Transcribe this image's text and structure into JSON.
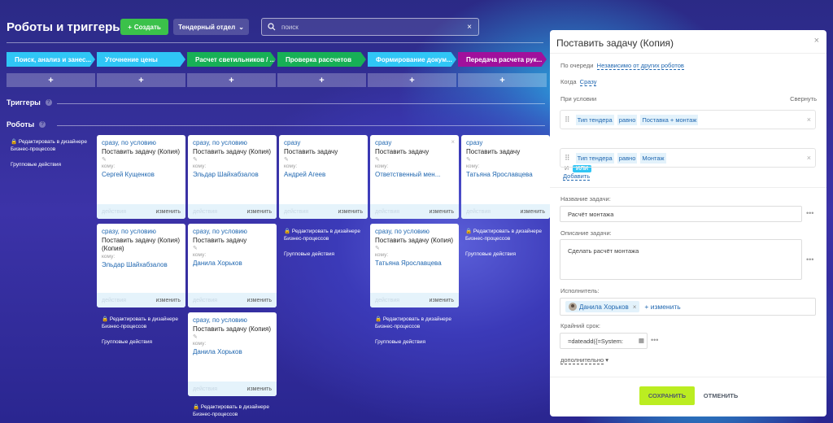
{
  "header": {
    "title": "Роботы и триггеры",
    "create_label": "Создать",
    "department_label": "Тендерный отдел",
    "search_placeholder": "поиск"
  },
  "stages": [
    {
      "label": "Поиск, анализ и занес...",
      "color": "#2fc6f6"
    },
    {
      "label": "Уточнение цены",
      "color": "#2fc6f6"
    },
    {
      "label": "Расчет светильников / ...",
      "color": "#17b056"
    },
    {
      "label": "Проверка рассчетов",
      "color": "#17b056"
    },
    {
      "label": "Формирование докум...",
      "color": "#2fc6f6"
    },
    {
      "label": "Передача расчета рук...",
      "color": "#a0109c"
    }
  ],
  "sections": {
    "triggers": "Триггеры",
    "robots": "Роботы"
  },
  "side_info": {
    "edit_line1": "Редактировать в дизайнере",
    "edit_line2": "Бизнес-процессов",
    "group_actions": "Групповые действия"
  },
  "cards": [
    {
      "cond": "сразу, по условию",
      "name": "Поставить задачу (Копия)",
      "to": "кому:",
      "assignee": "Сергей Кущенков",
      "footer_left": "действия",
      "footer_right": "изменить"
    },
    {
      "cond": "сразу, по условию",
      "name": "Поставить задачу (Копия)",
      "to": "кому:",
      "assignee": "Эльдар Шайхабзалов",
      "footer_left": "действия",
      "footer_right": "изменить"
    },
    {
      "cond": "сразу",
      "name": "Поставить задачу",
      "to": "кому:",
      "assignee": "Андрей Агеев",
      "footer_left": "действия",
      "footer_right": "изменить"
    },
    {
      "cond": "сразу",
      "name": "Поставить задачу",
      "to": "кому:",
      "assignee": "Ответственный мен...",
      "footer_left": "действия",
      "footer_right": "изменить"
    },
    {
      "cond": "сразу",
      "name": "Поставить задачу",
      "to": "кому:",
      "assignee": "Татьяна Ярославцева",
      "footer_left": "действия",
      "footer_right": "изменить"
    },
    {
      "cond": "сразу, по условию",
      "name": "Поставить задачу (Копия) (Копия)",
      "to": "кому:",
      "assignee": "Эльдар Шайхабзалов",
      "footer_left": "действия",
      "footer_right": "изменить"
    },
    {
      "cond": "сразу, по условию",
      "name": "Поставить задачу",
      "to": "кому:",
      "assignee": "Данила Хорьков",
      "footer_left": "действия",
      "footer_right": "изменить"
    },
    {
      "cond": "сразу, по условию",
      "name": "Поставить задачу (Копия)",
      "to": "кому:",
      "assignee": "Татьяна Ярославцева",
      "footer_left": "действия",
      "footer_right": "изменить"
    },
    {
      "cond": "сразу, по условию",
      "name": "Поставить задачу (Копия)",
      "to": "кому:",
      "assignee": "Данила Хорьков",
      "footer_left": "действия",
      "footer_right": "изменить"
    }
  ],
  "panel": {
    "title": "Поставить задачу (Копия)",
    "queue_label": "По очереди",
    "queue_value": "Независимо от других роботов",
    "when_label": "Когда",
    "when_value": "Сразу",
    "condition_label": "При условии",
    "collapse_label": "Свернуть",
    "conditions": [
      {
        "field": "Тип тендера",
        "op": "равно",
        "value": "Поставка + монтаж"
      },
      {
        "field": "Тип тендера",
        "op": "равно",
        "value": "Монтаж"
      }
    ],
    "and_label": "И",
    "or_label": "ИЛИ",
    "add_label": "Добавить",
    "task_name_label": "Название задачи:",
    "task_name_value": "Расчёт монтажа",
    "task_desc_label": "Описание задачи:",
    "task_desc_value": "Сделать расчёт монтажа",
    "executor_label": "Исполнитель:",
    "executor_name": "Данила Хорьков",
    "change_label": "+ изменить",
    "deadline_label": "Крайний срок:",
    "deadline_value": "=dateadd({=System:",
    "more_label": "дополнительно",
    "save_label": "СОХРАНИТЬ",
    "cancel_label": "ОТМЕНИТЬ"
  }
}
